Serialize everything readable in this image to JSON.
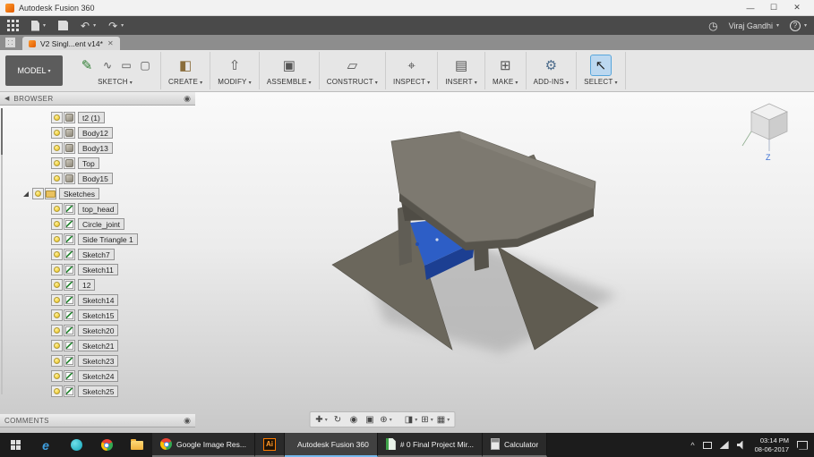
{
  "titlebar": {
    "title": "Autodesk Fusion 360"
  },
  "icons": {
    "minimize": "—",
    "maximize": "☐",
    "close": "✕",
    "undo": "↶",
    "redo": "↷",
    "job_status": "◷",
    "help": "?",
    "panel_back": "◀",
    "panel_target": "◉",
    "edge": "e",
    "chevron_up": "^",
    "sketch": "✎",
    "spline": "∿",
    "slot": "▭",
    "rectangle": "▢",
    "create": "◧",
    "modify": "⇧",
    "assemble": "▣",
    "construct": "▱",
    "inspect": "⌖",
    "insert": "▤",
    "make": "⊞",
    "addins": "⚙",
    "select": "↖",
    "pan": "✚",
    "orbit": "↻",
    "look_at": "◉",
    "zoom_window": "▣",
    "zoom": "⊕",
    "display": "◨",
    "grid": "⊞",
    "viewports": "▦"
  },
  "apptoolbar": {
    "user": "Viraj Gandhi"
  },
  "tabbar": {
    "active_tab": "V2 Singl...ent v14*"
  },
  "ribbon": {
    "model_label": "MODEL",
    "groups": [
      {
        "label": "SKETCH"
      },
      {
        "label": "CREATE"
      },
      {
        "label": "MODIFY"
      },
      {
        "label": "ASSEMBLE"
      },
      {
        "label": "CONSTRUCT"
      },
      {
        "label": "INSPECT"
      },
      {
        "label": "INSERT"
      },
      {
        "label": "MAKE"
      },
      {
        "label": "ADD-INS"
      },
      {
        "label": "SELECT"
      }
    ]
  },
  "viewcube": {
    "axis_z": "Z"
  },
  "browser": {
    "title": "BROWSER",
    "items": [
      {
        "label": "t2 (1)",
        "type": "body"
      },
      {
        "label": "Body12",
        "type": "body"
      },
      {
        "label": "Body13",
        "type": "body"
      },
      {
        "label": "Top",
        "type": "body"
      },
      {
        "label": "Body15",
        "type": "body"
      },
      {
        "label": "Sketches",
        "type": "folder"
      },
      {
        "label": "top_head",
        "type": "sketch"
      },
      {
        "label": "Circle_joint",
        "type": "sketch"
      },
      {
        "label": "Side Triangle 1",
        "type": "sketch"
      },
      {
        "label": "Sketch7",
        "type": "sketch"
      },
      {
        "label": "Sketch11",
        "type": "sketch"
      },
      {
        "label": "12",
        "type": "sketch"
      },
      {
        "label": "Sketch14",
        "type": "sketch"
      },
      {
        "label": "Sketch15",
        "type": "sketch"
      },
      {
        "label": "Sketch20",
        "type": "sketch"
      },
      {
        "label": "Sketch21",
        "type": "sketch"
      },
      {
        "label": "Sketch23",
        "type": "sketch"
      },
      {
        "label": "Sketch24",
        "type": "sketch"
      },
      {
        "label": "Sketch25",
        "type": "sketch"
      }
    ]
  },
  "comments": {
    "title": "COMMENTS"
  },
  "taskbar": {
    "windows": [
      {
        "label": "Google Image Res...",
        "icon": "chrome",
        "icon_text": ""
      },
      {
        "label": "",
        "icon": "ai",
        "icon_text": "Ai"
      },
      {
        "label": "Autodesk Fusion 360",
        "icon": "fusion-active",
        "icon_text": ""
      },
      {
        "label": "# 0 Final Project Mir...",
        "icon": "doc",
        "icon_text": ""
      },
      {
        "label": "Calculator",
        "icon": "calc",
        "icon_text": ""
      }
    ],
    "tray": {
      "time": "03:14 PM",
      "date": "08-06-2017"
    }
  }
}
